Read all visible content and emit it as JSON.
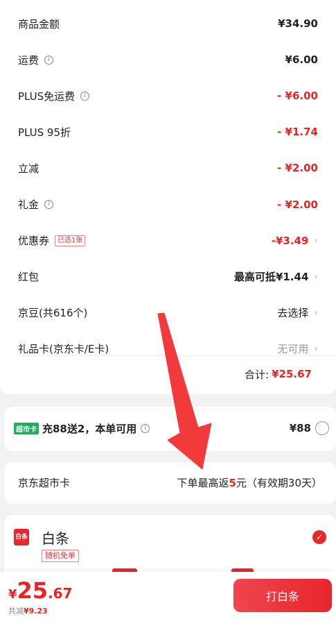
{
  "summary": {
    "rows": [
      {
        "label": "商品金额",
        "value": "¥34.90",
        "info": false,
        "tag": "",
        "chevron": false,
        "style": "normal-bold"
      },
      {
        "label": "运费",
        "value": "¥6.00",
        "info": true,
        "tag": "",
        "chevron": false,
        "style": "normal-bold"
      },
      {
        "label": "PLUS免运费",
        "value": "- ¥6.00",
        "info": true,
        "tag": "",
        "chevron": false,
        "style": "red"
      },
      {
        "label": "PLUS 95折",
        "value": "- ¥1.74",
        "info": false,
        "tag": "",
        "chevron": false,
        "style": "red"
      },
      {
        "label": "立减",
        "value": "- ¥2.00",
        "info": false,
        "tag": "",
        "chevron": false,
        "style": "red"
      },
      {
        "label": "礼金",
        "value": "- ¥2.00",
        "info": true,
        "tag": "",
        "chevron": false,
        "style": "red"
      },
      {
        "label": "优惠券",
        "value": "-¥3.49",
        "info": false,
        "tag": "已选1张",
        "chevron": true,
        "style": "red"
      },
      {
        "label": "红包",
        "value": "最高可抵¥1.44",
        "info": false,
        "tag": "",
        "chevron": true,
        "style": "normal-bold"
      },
      {
        "label": "京豆(共616个)",
        "value": "去选择",
        "info": false,
        "tag": "",
        "chevron": true,
        "style": "normal"
      },
      {
        "label": "礼品卡(京东卡/E卡)",
        "value": "无可用",
        "info": false,
        "tag": "",
        "chevron": true,
        "style": "gray"
      }
    ],
    "total_label": "合计:",
    "total_value": "¥25.67"
  },
  "supermarket_offer": {
    "badge": "超市卡",
    "text": "充88送2，本单可用",
    "price": "¥88"
  },
  "supermarket_card": {
    "label": "京东超市卡",
    "desc_prefix": "下单最高返",
    "desc_highlight": "5",
    "desc_suffix": "元（有效期30天）"
  },
  "payment": {
    "icon_text": "白条",
    "title": "白条",
    "tag": "随机免单"
  },
  "bottom": {
    "currency": "¥",
    "price_int": "25",
    "price_dec": ".67",
    "saved_label": "共减",
    "saved_value": "¥9.23",
    "pay_button": "打白条"
  },
  "colors": {
    "accent": "#e8262b",
    "green_badge": "#1fae5a"
  }
}
